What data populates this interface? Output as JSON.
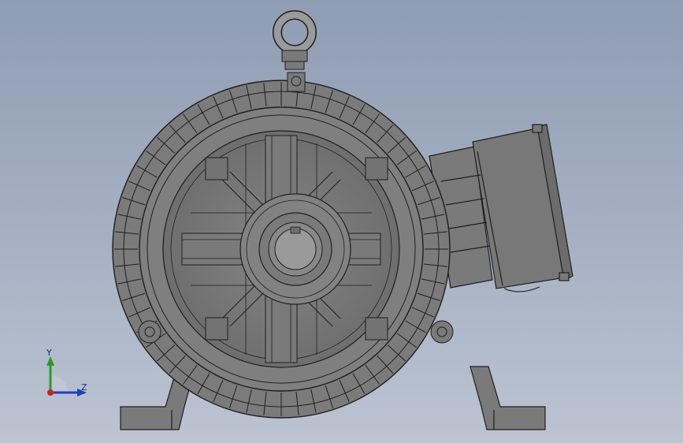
{
  "viewport": {
    "background_top": "#8f9db3",
    "background_bottom": "#bcc4d2"
  },
  "model": {
    "part_color": "#7a7a7a",
    "edge_color": "#1e1e1e",
    "eyebolt_color": "#9a9a9a"
  },
  "triad": {
    "y_label": "Y",
    "z_label": "Z",
    "y_color": "#2a9a2a",
    "z_color": "#1f3fbf",
    "x_color": "#c82020"
  }
}
